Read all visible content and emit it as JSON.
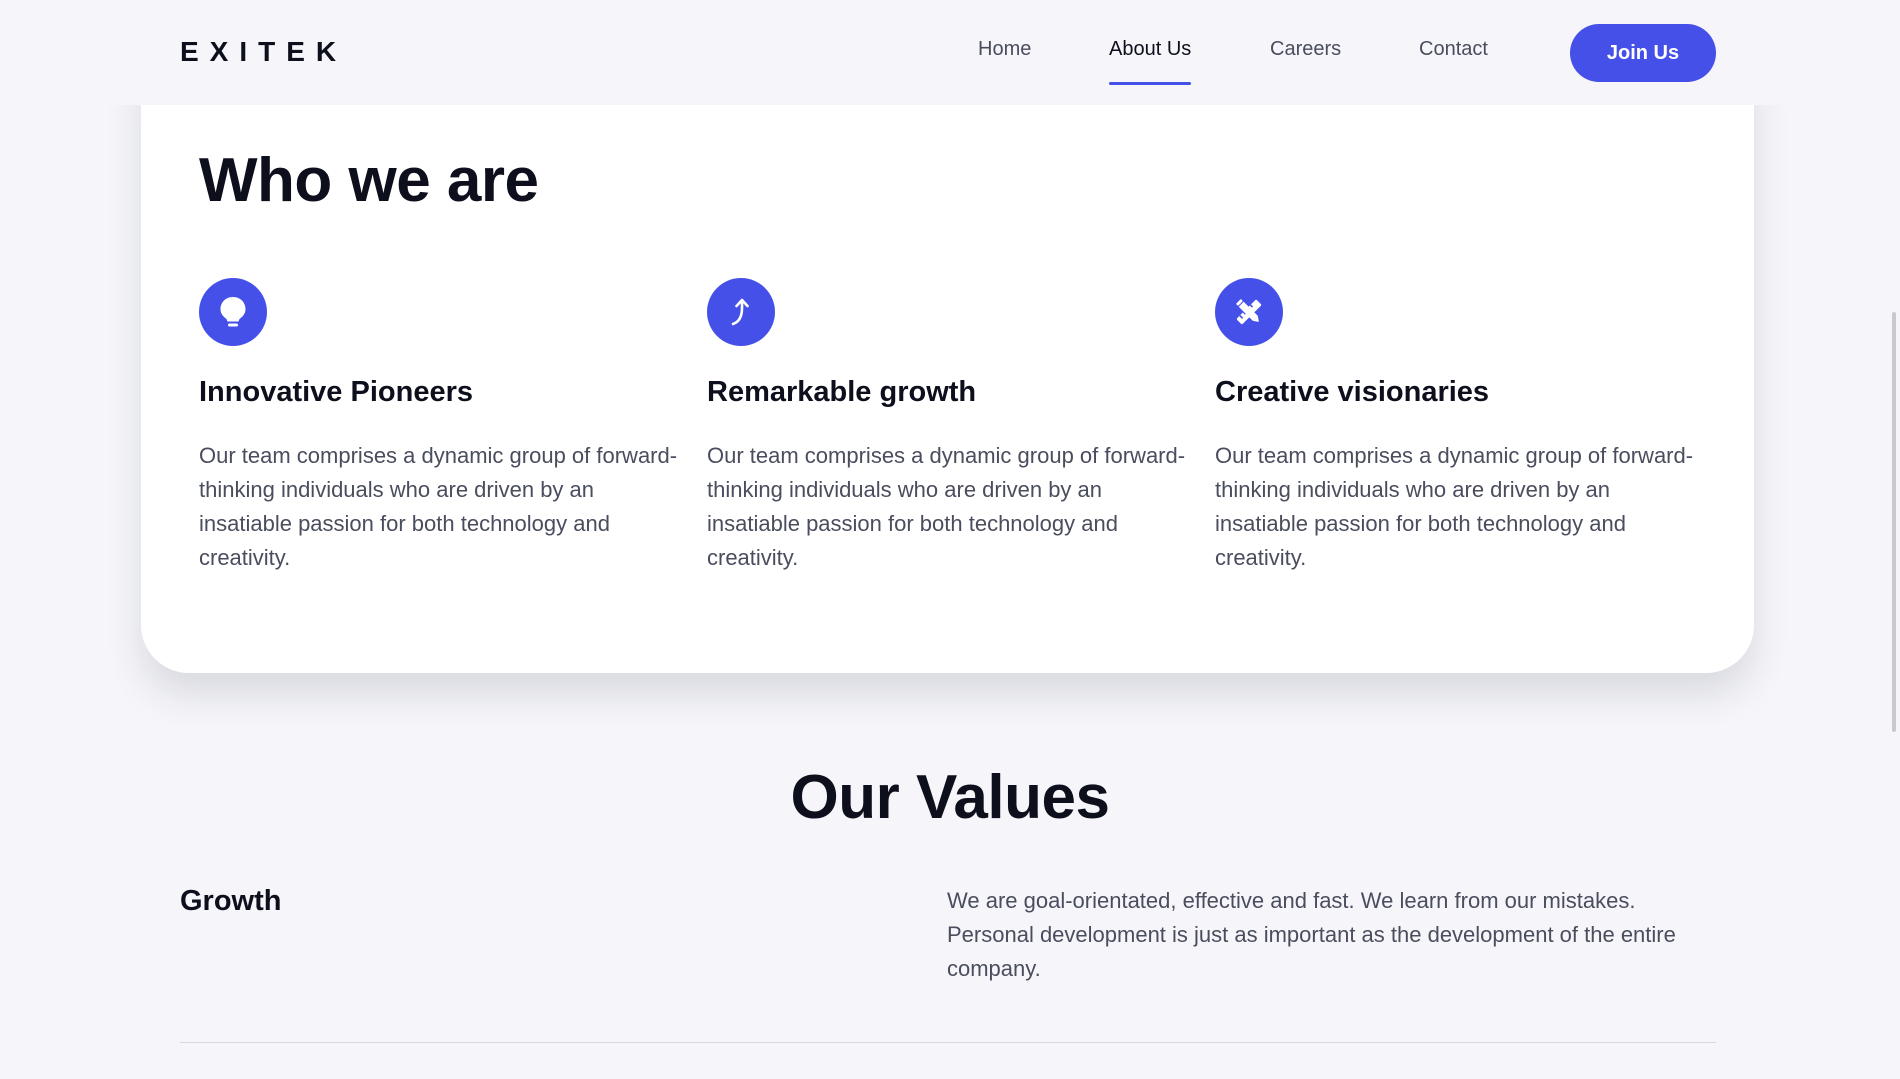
{
  "header": {
    "logo": "EXITEK",
    "nav": [
      {
        "label": "Home",
        "active": false
      },
      {
        "label": "About Us",
        "active": true
      },
      {
        "label": "Careers",
        "active": false
      },
      {
        "label": "Contact",
        "active": false
      }
    ],
    "cta_label": "Join Us"
  },
  "who": {
    "title": "Who we are",
    "features": [
      {
        "icon": "lightbulb-icon",
        "title": "Innovative Pioneers",
        "text": "Our team comprises a dynamic group of forward-thinking individuals who are driven by an insatiable passion for both technology and creativity."
      },
      {
        "icon": "growth-arrow-icon",
        "title": "Remarkable growth",
        "text": "Our team comprises a dynamic group of forward-thinking individuals who are driven by an insatiable passion for both technology and creativity."
      },
      {
        "icon": "design-tools-icon",
        "title": "Creative visionaries",
        "text": "Our team comprises a dynamic group of forward-thinking individuals who are driven by an insatiable passion for both technology and creativity."
      }
    ]
  },
  "values": {
    "title": "Our Values",
    "items": [
      {
        "name": "Growth",
        "description": "We are goal-orientated, effective and fast. We learn from our mistakes. Personal development is just as important as the development of the entire company."
      }
    ]
  },
  "colors": {
    "accent": "#4550e8",
    "background": "#f6f6fa",
    "card": "#ffffff",
    "heading": "#0d0f1c",
    "body_text": "#4a4d5e"
  }
}
